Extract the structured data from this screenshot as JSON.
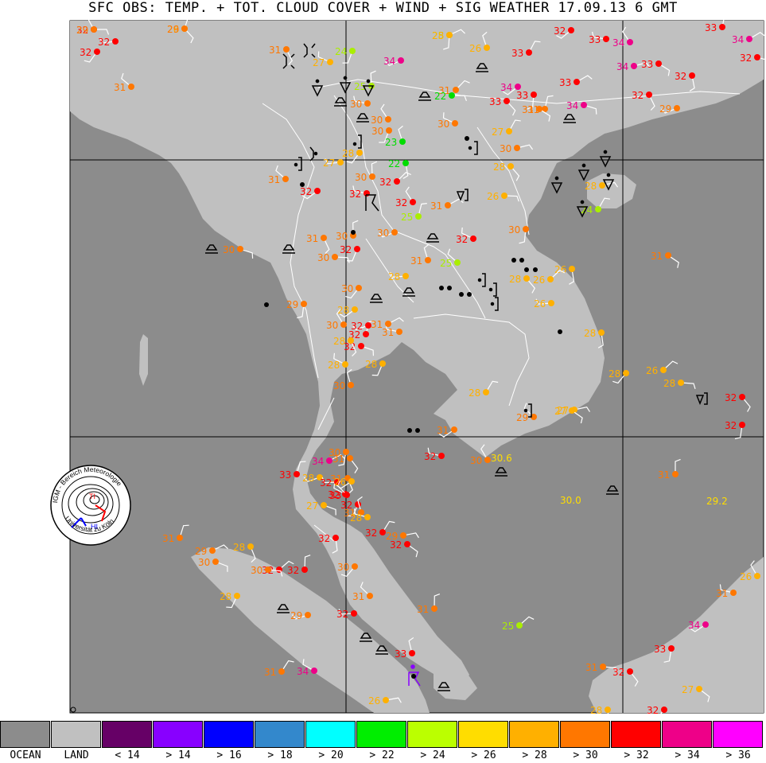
{
  "title": "SFC OBS: TEMP. + TOT. CLOUD COVER + WIND + SIG WEATHER 17.09.13 6  GMT",
  "colors": {
    "ocean": "#8c8c8c",
    "land": "#c0c0c0",
    "border": "#ffffff",
    "grid": "#000000"
  },
  "legend": [
    {
      "label": "OCEAN",
      "color": "#8c8c8c"
    },
    {
      "label": "LAND",
      "color": "#c0c0c0"
    },
    {
      "label": "< 14",
      "color": "#660066"
    },
    {
      "label": "> 14",
      "color": "#8800ff"
    },
    {
      "label": "> 16",
      "color": "#0000ff"
    },
    {
      "label": "> 18",
      "color": "#3388cc"
    },
    {
      "label": "> 20",
      "color": "#00ffff"
    },
    {
      "label": "> 22",
      "color": "#00ee00"
    },
    {
      "label": "> 24",
      "color": "#bbff00"
    },
    {
      "label": "> 26",
      "color": "#ffdd00"
    },
    {
      "label": "> 28",
      "color": "#ffb000"
    },
    {
      "label": "> 30",
      "color": "#ff7700"
    },
    {
      "label": "> 32",
      "color": "#ff0000"
    },
    {
      "label": "> 34",
      "color": "#ee0088"
    },
    {
      "label": "> 36",
      "color": "#ff00ff"
    }
  ],
  "logo": {
    "ring_text_top": "IGM - Bereich Meteorologie",
    "ring_text_bottom": "Universität zu Köln",
    "low": "TI",
    "high": "HI"
  },
  "stations": [
    {
      "t": "32",
      "c": "red"
    },
    {
      "t": "26",
      "c": "yellow"
    },
    {
      "t": "25",
      "c": "lime"
    },
    {
      "t": "32",
      "c": "red"
    },
    {
      "t": "33",
      "c": "red"
    },
    {
      "t": "34",
      "c": "magenta"
    },
    {
      "t": "33",
      "c": "red"
    },
    {
      "t": "34",
      "c": "magenta"
    },
    {
      "t": "32",
      "c": "red"
    },
    {
      "t": "31",
      "c": "orange"
    },
    {
      "t": "24",
      "c": "lime"
    },
    {
      "t": "34",
      "c": "magenta"
    },
    {
      "t": "27",
      "c": "yellow"
    },
    {
      "t": "26",
      "c": "yellow"
    },
    {
      "t": "33",
      "c": "red"
    },
    {
      "t": "34",
      "c": "magenta"
    },
    {
      "t": "33",
      "c": "red"
    },
    {
      "t": "32",
      "c": "red"
    },
    {
      "t": "32",
      "c": "red"
    },
    {
      "t": "32",
      "c": "red"
    },
    {
      "t": "31",
      "c": "orange"
    },
    {
      "t": "25",
      "c": "lime"
    },
    {
      "t": "31",
      "c": "orange"
    },
    {
      "t": "22",
      "c": "green"
    },
    {
      "t": "33",
      "c": "red"
    },
    {
      "t": "33",
      "c": "red"
    },
    {
      "t": "34",
      "c": "magenta"
    },
    {
      "t": "30",
      "c": "orange"
    },
    {
      "t": "30",
      "c": "orange"
    },
    {
      "t": "31",
      "c": "orange"
    },
    {
      "t": "33",
      "c": "red"
    },
    {
      "t": "34",
      "c": "magenta"
    },
    {
      "t": "32",
      "c": "red"
    },
    {
      "t": "30",
      "c": "orange"
    },
    {
      "t": "29",
      "c": "orange"
    },
    {
      "t": "30",
      "c": "orange"
    },
    {
      "t": "23",
      "c": "green"
    },
    {
      "t": "27",
      "c": "yellow"
    },
    {
      "t": "30",
      "c": "orange"
    },
    {
      "t": "31",
      "c": "orange"
    },
    {
      "t": "22",
      "c": "green"
    },
    {
      "t": "28",
      "c": "yellow"
    },
    {
      "t": "27",
      "c": "yellow"
    },
    {
      "t": "31",
      "c": "orange"
    },
    {
      "t": "30",
      "c": "orange"
    },
    {
      "t": "32",
      "c": "red"
    },
    {
      "t": "26",
      "c": "yellow"
    },
    {
      "t": "28",
      "c": "yellow"
    },
    {
      "t": "30",
      "c": "orange"
    },
    {
      "t": "32",
      "c": "red"
    },
    {
      "t": "32",
      "c": "red"
    },
    {
      "t": "32",
      "c": "red"
    },
    {
      "t": "25",
      "c": "lime"
    },
    {
      "t": "31",
      "c": "orange"
    },
    {
      "t": "30",
      "c": "orange"
    },
    {
      "t": "31",
      "c": "orange"
    },
    {
      "t": "32",
      "c": "red"
    },
    {
      "t": "30",
      "c": "orange"
    },
    {
      "t": "32",
      "c": "red"
    },
    {
      "t": "31",
      "c": "orange"
    },
    {
      "t": "24",
      "c": "lime"
    },
    {
      "t": "28",
      "c": "yellow"
    },
    {
      "t": "31",
      "c": "orange"
    },
    {
      "t": "26",
      "c": "yellow"
    },
    {
      "t": "30",
      "c": "orange"
    },
    {
      "t": "28",
      "c": "yellow"
    },
    {
      "t": "25",
      "c": "lime"
    },
    {
      "t": "30",
      "c": "orange"
    },
    {
      "t": "26",
      "c": "yellow"
    },
    {
      "t": "30",
      "c": "orange"
    },
    {
      "t": "28",
      "c": "yellow"
    },
    {
      "t": "29",
      "c": "orange"
    },
    {
      "t": "28",
      "c": "yellow"
    },
    {
      "t": "31",
      "c": "orange"
    },
    {
      "t": "30",
      "c": "orange"
    },
    {
      "t": "32",
      "c": "red"
    },
    {
      "t": "31",
      "c": "orange"
    },
    {
      "t": "32",
      "c": "red"
    },
    {
      "t": "28",
      "c": "yellow"
    },
    {
      "t": "28",
      "c": "yellow"
    },
    {
      "t": "32",
      "c": "red"
    },
    {
      "t": "28",
      "c": "yellow"
    },
    {
      "t": "30",
      "c": "orange"
    },
    {
      "t": "28",
      "c": "yellow"
    },
    {
      "t": "27",
      "c": "yellow"
    },
    {
      "t": "27",
      "c": "yellow"
    },
    {
      "t": "28",
      "c": "yellow"
    },
    {
      "t": "28",
      "c": "yellow"
    },
    {
      "t": "26",
      "c": "yellow"
    },
    {
      "t": "29",
      "c": "orange"
    },
    {
      "t": "31",
      "c": "orange"
    },
    {
      "t": "26",
      "c": "yellow"
    },
    {
      "t": "28",
      "c": "yellow"
    },
    {
      "t": "32",
      "c": "red"
    },
    {
      "t": "32",
      "c": "red"
    },
    {
      "t": "31",
      "c": "orange"
    },
    {
      "t": "32",
      "c": "red"
    },
    {
      "t": "30",
      "c": "orange"
    },
    {
      "t": "33",
      "c": "red"
    },
    {
      "t": "34",
      "c": "magenta"
    },
    {
      "t": "27",
      "c": "yellow"
    },
    {
      "t": "31",
      "c": "orange"
    },
    {
      "t": "32",
      "c": "red"
    },
    {
      "t": "28",
      "c": "yellow"
    },
    {
      "t": "32",
      "c": "red"
    },
    {
      "t": "31",
      "c": "orange"
    },
    {
      "t": "32",
      "c": "red"
    },
    {
      "t": "29",
      "c": "orange"
    },
    {
      "t": "32",
      "c": "red"
    },
    {
      "t": "32",
      "c": "red"
    },
    {
      "t": "30",
      "c": "orange"
    },
    {
      "t": "32",
      "c": "red"
    },
    {
      "t": "31",
      "c": "orange"
    },
    {
      "t": "31",
      "c": "orange"
    },
    {
      "t": "25",
      "c": "lime"
    },
    {
      "t": "31",
      "c": "orange"
    },
    {
      "t": "32",
      "c": "red"
    },
    {
      "t": "33",
      "c": "red"
    },
    {
      "t": "34",
      "c": "magenta"
    },
    {
      "t": "31",
      "c": "orange"
    },
    {
      "t": "26",
      "c": "yellow"
    },
    {
      "t": "31",
      "c": "orange"
    },
    {
      "t": "29",
      "c": "orange"
    },
    {
      "t": "30",
      "c": "orange"
    },
    {
      "t": "28",
      "c": "yellow"
    },
    {
      "t": "28",
      "c": "yellow"
    },
    {
      "t": "29",
      "c": "orange"
    },
    {
      "t": "34",
      "c": "magenta"
    },
    {
      "t": "33",
      "c": "red"
    },
    {
      "t": "31",
      "c": "orange"
    },
    {
      "t": "26",
      "c": "yellow"
    },
    {
      "t": "27",
      "c": "yellow"
    },
    {
      "t": "28",
      "c": "yellow"
    },
    {
      "t": "32",
      "c": "red"
    },
    {
      "t": "32",
      "c": "red"
    },
    {
      "t": "33",
      "c": "red"
    },
    {
      "t": "32",
      "c": "red"
    },
    {
      "t": "32",
      "c": "red"
    },
    {
      "t": "30",
      "c": "orange"
    },
    {
      "t": "31",
      "c": "orange"
    },
    {
      "t": "30",
      "c": "orange"
    },
    {
      "t": "26",
      "c": "yellow"
    },
    {
      "t": "28",
      "c": "yellow"
    },
    {
      "t": "29",
      "c": "orange"
    },
    {
      "t": "29",
      "c": "orange"
    },
    {
      "t": "28",
      "c": "yellow"
    }
  ],
  "plain_values": [
    "29.2",
    "30.0",
    "30.6"
  ]
}
